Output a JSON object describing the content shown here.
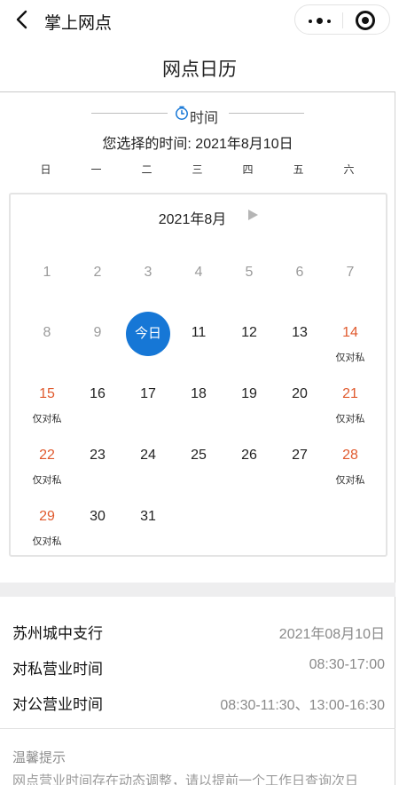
{
  "navbar": {
    "title": "掌上网点",
    "icons": {
      "back": "back-chevron-icon",
      "more": "more-dots-icon",
      "close": "close-target-icon"
    }
  },
  "page": {
    "title": "网点日历"
  },
  "time_header": {
    "label": "时间",
    "icon": "clock-icon"
  },
  "selected_time": "您选择的时间: 2021年8月10日",
  "weekdays": [
    "日",
    "一",
    "二",
    "三",
    "四",
    "五",
    "六"
  ],
  "calendar": {
    "month_title": "2021年8月",
    "days": [
      {
        "num": "1",
        "state": "past",
        "note": ""
      },
      {
        "num": "2",
        "state": "past",
        "note": ""
      },
      {
        "num": "3",
        "state": "past",
        "note": ""
      },
      {
        "num": "4",
        "state": "past",
        "note": ""
      },
      {
        "num": "5",
        "state": "past",
        "note": ""
      },
      {
        "num": "6",
        "state": "past",
        "note": ""
      },
      {
        "num": "7",
        "state": "past",
        "note": ""
      },
      {
        "num": "8",
        "state": "past",
        "note": ""
      },
      {
        "num": "9",
        "state": "past",
        "note": ""
      },
      {
        "num": "今日",
        "state": "today",
        "note": ""
      },
      {
        "num": "11",
        "state": "normal",
        "note": ""
      },
      {
        "num": "12",
        "state": "normal",
        "note": ""
      },
      {
        "num": "13",
        "state": "normal",
        "note": ""
      },
      {
        "num": "14",
        "state": "weekend",
        "note": "仅对私"
      },
      {
        "num": "15",
        "state": "weekend",
        "note": "仅对私"
      },
      {
        "num": "16",
        "state": "normal",
        "note": ""
      },
      {
        "num": "17",
        "state": "normal",
        "note": ""
      },
      {
        "num": "18",
        "state": "normal",
        "note": ""
      },
      {
        "num": "19",
        "state": "normal",
        "note": ""
      },
      {
        "num": "20",
        "state": "normal",
        "note": ""
      },
      {
        "num": "21",
        "state": "weekend",
        "note": "仅对私"
      },
      {
        "num": "22",
        "state": "weekend",
        "note": "仅对私"
      },
      {
        "num": "23",
        "state": "normal",
        "note": ""
      },
      {
        "num": "24",
        "state": "normal",
        "note": ""
      },
      {
        "num": "25",
        "state": "normal",
        "note": ""
      },
      {
        "num": "26",
        "state": "normal",
        "note": ""
      },
      {
        "num": "27",
        "state": "normal",
        "note": ""
      },
      {
        "num": "28",
        "state": "weekend",
        "note": "仅对私"
      },
      {
        "num": "29",
        "state": "weekend",
        "note": "仅对私"
      },
      {
        "num": "30",
        "state": "normal",
        "note": ""
      },
      {
        "num": "31",
        "state": "normal",
        "note": ""
      }
    ]
  },
  "info": {
    "branch_name": "苏州城中支行",
    "date": "2021年08月10日",
    "private_label": "对私营业时间",
    "private_hours": "08:30-17:00",
    "corporate_label": "对公营业时间",
    "corporate_hours": "08:30-11:30、13:00-16:30"
  },
  "tips": {
    "title": "温馨提示",
    "text": "网点营业时间存在动态调整，请以提前一个工作日查询次日"
  },
  "colors": {
    "accent": "#1677d6",
    "weekend": "#e05a2e",
    "past": "#9b9b9b",
    "muted": "#8a8a8a",
    "separator": "#eeeeef"
  }
}
